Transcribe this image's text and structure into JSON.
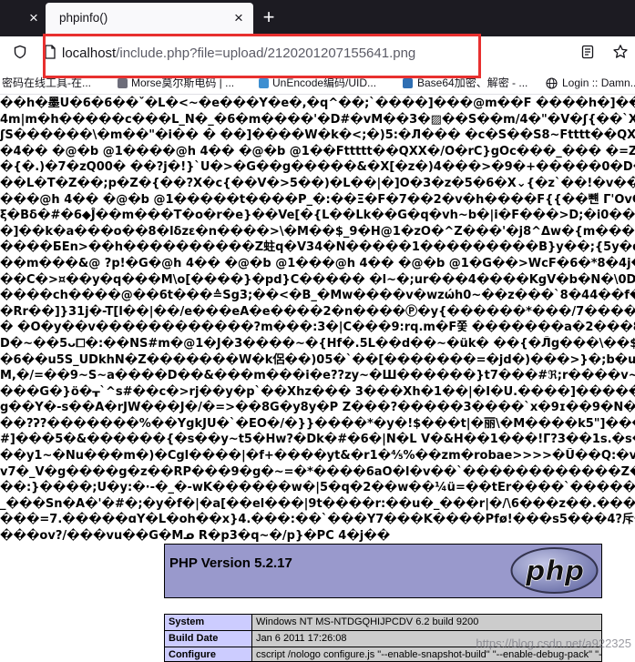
{
  "browser": {
    "tabs": {
      "prev_close": "×",
      "active": {
        "title": "phpinfo()",
        "close": "×"
      },
      "new_tab": "+"
    },
    "nav": {
      "url_host": "localhost",
      "url_path": "/include.php?file=upload/2120201207155641.png"
    },
    "bookmarks": [
      {
        "label": "密码在线工具-在..."
      },
      {
        "label": "Morse莫尔斯电码 | ..."
      },
      {
        "label": "UnEncode编码/UID..."
      },
      {
        "label": "Base64加密、解密 - ..."
      },
      {
        "label": "Login :: Damn..."
      }
    ],
    "icons": {
      "tracking": "shield-icon",
      "site": "page-icon",
      "reader": "reader-view-icon",
      "bookmark": "star-icon",
      "login_favicon": "globe-icon"
    },
    "highlight_color": "#e8302f"
  },
  "page": {
    "garbled_lines": [
      "��h�墨U�6�6��ˇ�L�<~�e���Y�e�,�q^��;`����]���@m��F ����h�]����qSeꞓ��q%&^dZ",
      "4m|m�h�����c���L_N�_�6�m����'�D#�vM��3�▨��S��m/4�\"�V�ʃ{��`Xα&E+a����k� �",
      "ʃS������\\�m��\"�i�� � ��]����W�k�<;�)5:�Л��� �c�S��S8~Ftttt��QXX�/O�rC8��f1",
      "�4�� �@�b @1����@h 4�� �@�b @1��Fttttt��QXX�/O�rC}gOc���_��� �=Z&��������",
      "�{�.)�7�zQ00� ��?j�!}`U�>�G��g�����&�X[�z�)4���>�9�+�����0�D��n������",
      "��L�T�Z��;p�Z�{��?X�c{��V�>5��)�L��|�]O�3�z�5�6�X⌄{�z`��!�v�����G∆VI�Ph��4",
      "���@h 4�� �@�b @1�����t����P_�:��Ξ�F�7��2�v�h����F{{��뺸 Γ'OvC��O>!@��5�4M",
      "ξ�Bδ�#�6◆Ĵ��m���T�o�r�e}��Ve[�{L��Lk��G�q�vh~b�|i�F���>D;�i0��3��u�fx}3t��+��",
      "�]��k�a���o��8�lδzε�n����>\\�M��$_9�H@1�ᴢO�^Z���'�j8^Δw�{m���8;ä~;JY�k���Z",
      "����БЕn>��h����������Z蛀q�V34�N�����1���������B}y��;{5y�d7�[�1v�▒���O>�D",
      "��m���&@ ?p!�G�@h 4�� �@�b @1���@h 4�� �@�b @1�G��>WcF�6�*8�4j�6����C���W",
      "��C�>¤��y�q���M\\o[����}�pd}C����� �l~�;ur���4����KgV�b�N�\\0D����NΠBb@��",
      "����ch����@��6t���≙Sg3;��<�B_�Mw����v�wzώh0~��z���`8�44��f���;�2����ποi�5",
      "�Rr��]}31j�-T[l��|��/e���eA�e����2�n����Ⓟ�y{������*���/7����` �U��Y�ot�v]",
      "� �O�y��v������������?m���:3�|C���9:rq.m�F쫓 �������a�2���8o����`X��u>Vj�",
      "D�~��5ᴗ⧠�:��NS#m�@1�J�3����~�{Hf�.5L��d��~�ük� ��{�Л̄g���\\��$�,�Fy��L�w�",
      "�6��u5S_UDkhN�Z�������W�k侶��)05�`��[�������=�jd�)���>}�;b�u�t�l~���&",
      "M,�/=��9~S~a����D��&���m���i�e??zy~�Ш������}t7���#ℜ;r����v~���b����Z}U",
      "���G�}ö�ᚁ`^s#��c�>rj��y�p`��Xhz��� 3���Xh�1��|�I�U.����]�����vH��Ku&ʒg,X",
      "g��Y�-s��A�rJW���J�/�=>��8G�y8y�P Z���?�����3����`x�9ɪ��9�N��3���",
      "��?ʔ?�������%��YgkJU�`�EO�/�}}����*�y�!$���t|�丽\\�M����k5\"]���Yg�9X�Z���o,s",
      "#]���5�&������{�s��y~t5�Hw?�Dk�#�6�|N�L V�&H��1���!ᒥ?3��1s.�s��@\\�������",
      "��y1~�Nu���m�)�Cgl����|�f+����yt&�r1�⅘%��zm�robae>>>>�Ũ��Q:�v�����Y��",
      "v7�_V�g����g�z��RP���9�g�~=�*����6aO�l�v��`������������Z�RZwoh_�v�z�",
      "��:}����;U�y:�·-�_�-wK������w�|5�q�2��w��¼ü=��tEr����`������re�~>A�붬�V",
      "_���Sn�A�'�#�;�y�f�|�a[��el���|9t����r:��u�_���r|�/\\6���z��.������p�3��������",
      "���=7.�����ɑY�L�oh��x}4.���:��`���Y7���K����Pfø!���s5���4?斥��+c�g�",
      "���ov?/���vu��G�Mᓄ R�p3�q~�/p}�PC 4�j��"
    ],
    "phpinfo": {
      "header_title": "PHP Version 5.2.17",
      "logo_text": "php",
      "rows": [
        {
          "label": "System",
          "value": "Windows NT MS-NTDGQHIJPCDV 6.2 build 9200"
        },
        {
          "label": "Build Date",
          "value": "Jan 6 2011 17:26:08"
        },
        {
          "label": "Configure",
          "value": "cscript /nologo configure.js \"--enable-snapshot-build\" \"--enable-debug-pack\" \"--"
        }
      ],
      "colors": {
        "header_bg": "#9999cc",
        "label_bg": "#ccccff",
        "value_bg": "#cccccc"
      }
    },
    "watermark": "https://blog.csdn.net/a922325"
  }
}
